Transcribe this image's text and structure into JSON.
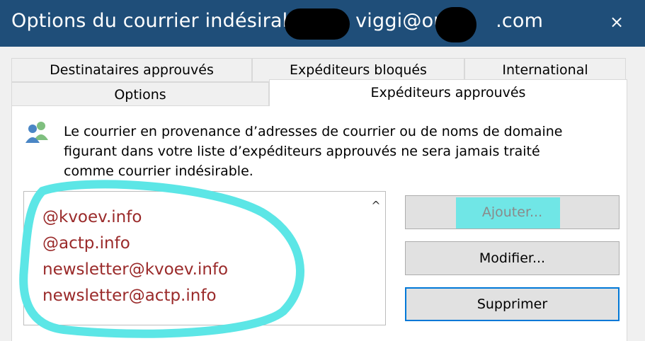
{
  "window": {
    "title_prefix": "Options du courrier indésirab",
    "title_mid": "viggi@outl",
    "title_suffix": ".com",
    "close_glyph": "×"
  },
  "tabs": {
    "row1": [
      "Destinataires approuvés",
      "Expéditeurs bloqués",
      "International"
    ],
    "row2": [
      "Options",
      "Expéditeurs approuvés"
    ]
  },
  "description": [
    "Le courrier en provenance d’adresses de courrier ou de noms de domaine",
    "figurant dans votre liste d’expéditeurs approuvés ne sera jamais traité",
    "comme courrier indésirable."
  ],
  "list": {
    "items": [
      "@kvoev.info",
      "@actp.info",
      "newsletter@kvoev.info",
      "newsletter@actp.info"
    ],
    "scroll_glyph": "^"
  },
  "buttons": {
    "add": "Ajouter...",
    "edit": "Modifier...",
    "delete": "Supprimer"
  },
  "colors": {
    "titlebar": "#1f4e79",
    "annotation": "#5ce6e6",
    "list_text": "#9a2a2a",
    "focus": "#0078d7"
  },
  "icons": {
    "description_icon": "users-icon",
    "close": "close-icon",
    "scroll": "chevron-up-icon"
  }
}
